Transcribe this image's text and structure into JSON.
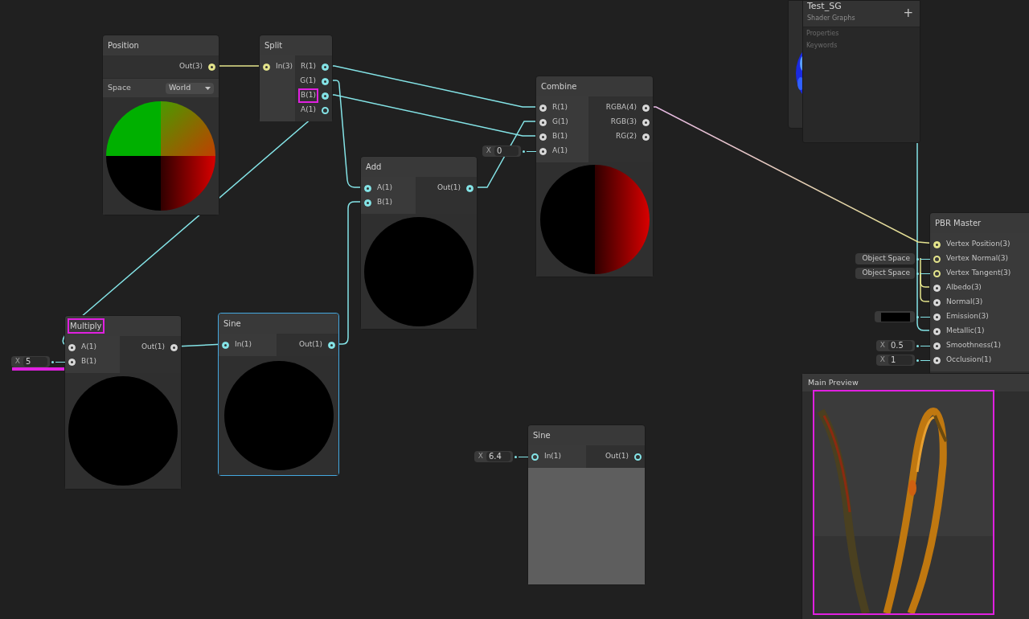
{
  "background_panel": {
    "preview": {
      "kind": "noise"
    }
  },
  "blackboard": {
    "title": "Test_SG",
    "subtitle": "Shader Graphs",
    "add_symbol": "+",
    "sections": [
      "Properties",
      "Keywords"
    ]
  },
  "nodes": [
    {
      "title": "Position",
      "selected": false,
      "highlighted": false,
      "outputs": [
        {
          "label": "Out(3)",
          "filled": true,
          "color": "#e4e48b",
          "highlighted": false
        }
      ],
      "control": {
        "label": "Space",
        "value": "World"
      },
      "preview": {
        "kind": "position"
      }
    },
    {
      "title": "Split",
      "selected": false,
      "highlighted": false,
      "inputs": [
        {
          "label": "In(3)",
          "filled": true,
          "color": "#e4e48b",
          "highlighted": false
        }
      ],
      "outputs": [
        {
          "label": "R(1)",
          "filled": true,
          "color": "#84e4e7",
          "highlighted": false
        },
        {
          "label": "G(1)",
          "filled": true,
          "color": "#84e4e7",
          "highlighted": false
        },
        {
          "label": "B(1)",
          "filled": true,
          "color": "#84e4e7",
          "highlighted": true
        },
        {
          "label": "A(1)",
          "filled": false,
          "color": "#84e4e7",
          "highlighted": false
        }
      ]
    },
    {
      "title": "Combine",
      "selected": false,
      "highlighted": false,
      "inputs": [
        {
          "label": "R(1)",
          "filled": true,
          "color": "#d9d9d9",
          "highlighted": false
        },
        {
          "label": "G(1)",
          "filled": true,
          "color": "#d9d9d9",
          "highlighted": false
        },
        {
          "label": "B(1)",
          "filled": true,
          "color": "#d9d9d9",
          "highlighted": false
        },
        {
          "label": "A(1)",
          "filled": true,
          "color": "#d9d9d9",
          "highlighted": false,
          "field": {
            "kind": "number",
            "label": "X",
            "value": "0",
            "highlighted": false
          }
        }
      ],
      "outputs": [
        {
          "label": "RGBA(4)",
          "filled": true,
          "color": "#d9d9d9",
          "highlighted": false
        },
        {
          "label": "RGB(3)",
          "filled": true,
          "color": "#d9d9d9",
          "highlighted": false
        },
        {
          "label": "RG(2)",
          "filled": true,
          "color": "#d9d9d9",
          "highlighted": false
        }
      ],
      "preview": {
        "kind": "red-half"
      }
    },
    {
      "title": "Add",
      "selected": false,
      "highlighted": false,
      "inputs": [
        {
          "label": "A(1)",
          "filled": true,
          "color": "#84e4e7",
          "highlighted": false
        },
        {
          "label": "B(1)",
          "filled": true,
          "color": "#84e4e7",
          "highlighted": false
        }
      ],
      "outputs": [
        {
          "label": "Out(1)",
          "filled": true,
          "color": "#84e4e7",
          "highlighted": false
        }
      ],
      "preview": {
        "kind": "black"
      }
    },
    {
      "title": "Multiply",
      "selected": false,
      "highlighted": true,
      "inputs": [
        {
          "label": "A(1)",
          "filled": true,
          "color": "#d9d9d9",
          "highlighted": false
        },
        {
          "label": "B(1)",
          "filled": true,
          "color": "#d9d9d9",
          "highlighted": false,
          "field": {
            "kind": "number",
            "label": "X",
            "value": "5",
            "highlighted": true
          }
        }
      ],
      "outputs": [
        {
          "label": "Out(1)",
          "filled": true,
          "color": "#d9d9d9",
          "highlighted": false
        }
      ],
      "preview": {
        "kind": "black"
      }
    },
    {
      "title": "Sine",
      "selected": true,
      "highlighted": false,
      "inputs": [
        {
          "label": "In(1)",
          "filled": true,
          "color": "#84e4e7",
          "highlighted": false
        }
      ],
      "outputs": [
        {
          "label": "Out(1)",
          "filled": true,
          "color": "#84e4e7",
          "highlighted": false
        }
      ],
      "preview": {
        "kind": "black"
      }
    },
    {
      "title": "Sine",
      "selected": false,
      "highlighted": false,
      "inputs": [
        {
          "label": "In(1)",
          "filled": false,
          "color": "#84e4e7",
          "highlighted": false,
          "field": {
            "kind": "number",
            "label": "X",
            "value": "6.4",
            "highlighted": false
          }
        }
      ],
      "outputs": [
        {
          "label": "Out(1)",
          "filled": false,
          "color": "#84e4e7",
          "highlighted": false
        }
      ],
      "preview": {
        "kind": "flat"
      }
    },
    {
      "title": "PBR Master",
      "selected": false,
      "highlighted": false,
      "inputs": [
        {
          "label": "Vertex Position(3)",
          "filled": true,
          "color": "#e4e48b",
          "highlighted": false
        },
        {
          "label": "Vertex Normal(3)",
          "filled": false,
          "color": "#e4e48b",
          "highlighted": false,
          "field": {
            "kind": "text",
            "value": "Object Space",
            "highlighted": false
          }
        },
        {
          "label": "Vertex Tangent(3)",
          "filled": false,
          "color": "#e4e48b",
          "highlighted": false,
          "field": {
            "kind": "text",
            "value": "Object Space",
            "highlighted": false
          }
        },
        {
          "label": "Albedo(3)",
          "filled": true,
          "color": "#d9d9d9",
          "highlighted": false
        },
        {
          "label": "Normal(3)",
          "filled": true,
          "color": "#d9d9d9",
          "highlighted": false
        },
        {
          "label": "Emission(3)",
          "filled": true,
          "color": "#d9d9d9",
          "highlighted": false,
          "field": {
            "kind": "swatch",
            "color": "#000000",
            "highlighted": false
          }
        },
        {
          "label": "Metallic(1)",
          "filled": true,
          "color": "#d9d9d9",
          "highlighted": false
        },
        {
          "label": "Smoothness(1)",
          "filled": true,
          "color": "#d9d9d9",
          "highlighted": false,
          "field": {
            "kind": "number",
            "label": "X",
            "value": "0.5",
            "highlighted": false
          }
        },
        {
          "label": "Occlusion(1)",
          "filled": true,
          "color": "#d9d9d9",
          "highlighted": false,
          "field": {
            "kind": "number",
            "label": "X",
            "value": "1",
            "highlighted": false
          }
        }
      ]
    }
  ],
  "main_preview": {
    "title": "Main Preview",
    "highlighted": true
  }
}
